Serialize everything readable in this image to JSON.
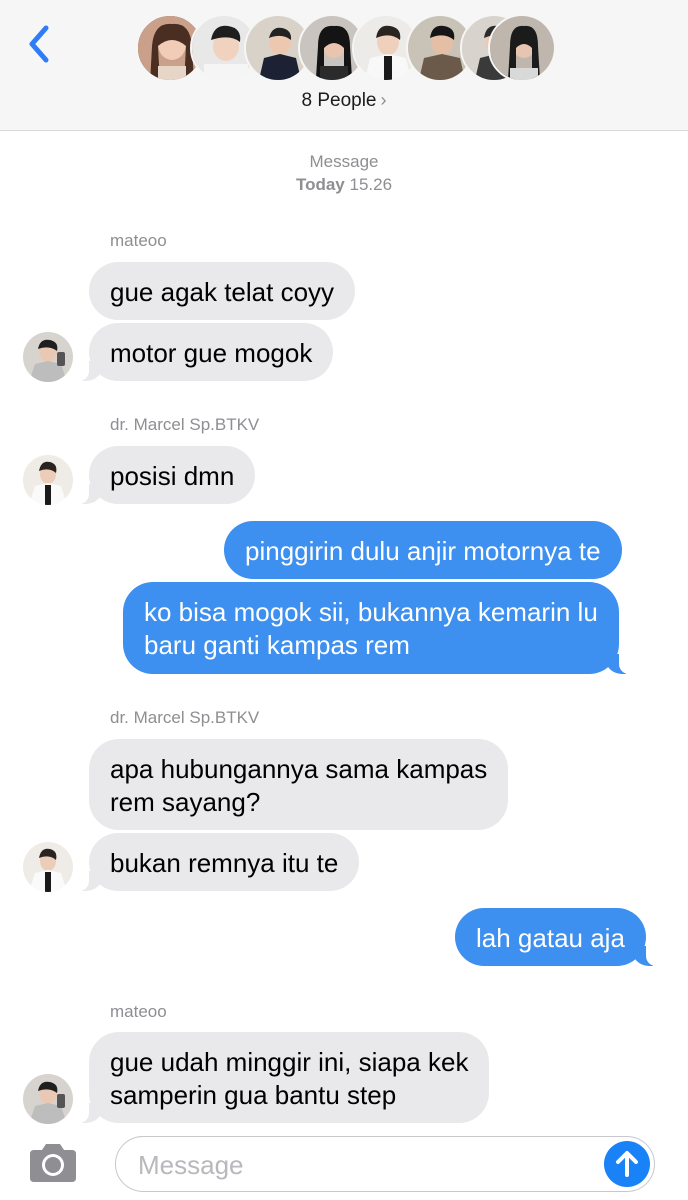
{
  "header": {
    "people_label": "8 People",
    "back_icon": "chevron-left-icon",
    "accent": "#2f7cf6"
  },
  "stamp": {
    "label": "Message",
    "day": "Today",
    "time": "15.26"
  },
  "messages": [
    {
      "sender": "mateoo",
      "direction": "incoming",
      "lines": [
        "gue agak telat coyy"
      ]
    },
    {
      "sender": "mateoo",
      "direction": "incoming",
      "lines": [
        "motor gue mogok"
      ]
    },
    {
      "sender": "dr. Marcel Sp.BTKV",
      "direction": "incoming",
      "lines": [
        "posisi dmn"
      ]
    },
    {
      "sender": "me",
      "direction": "outgoing",
      "lines": [
        "pinggirin dulu anjir motornya te"
      ]
    },
    {
      "sender": "me",
      "direction": "outgoing",
      "lines": [
        "ko bisa mogok sii, bukannya kemarin lu",
        "baru ganti kampas rem"
      ]
    },
    {
      "sender": "dr. Marcel Sp.BTKV",
      "direction": "incoming",
      "lines": [
        "apa hubungannya sama kampas",
        "rem sayang?"
      ]
    },
    {
      "sender": "dr. Marcel Sp.BTKV",
      "direction": "incoming",
      "lines": [
        "bukan remnya itu te"
      ]
    },
    {
      "sender": "me",
      "direction": "outgoing",
      "lines": [
        "lah gatau aja"
      ]
    },
    {
      "sender": "mateoo",
      "direction": "incoming",
      "lines": [
        "gue udah minggir ini, siapa kek",
        "samperin gua bantu step"
      ]
    }
  ],
  "composer": {
    "placeholder": "Message",
    "camera_icon": "camera-icon",
    "send_icon": "send-arrow-icon"
  },
  "colors": {
    "incoming_bubble": "#e9e9eb",
    "outgoing_bubble": "#3d8ff0",
    "send_button": "#1a82f7"
  }
}
